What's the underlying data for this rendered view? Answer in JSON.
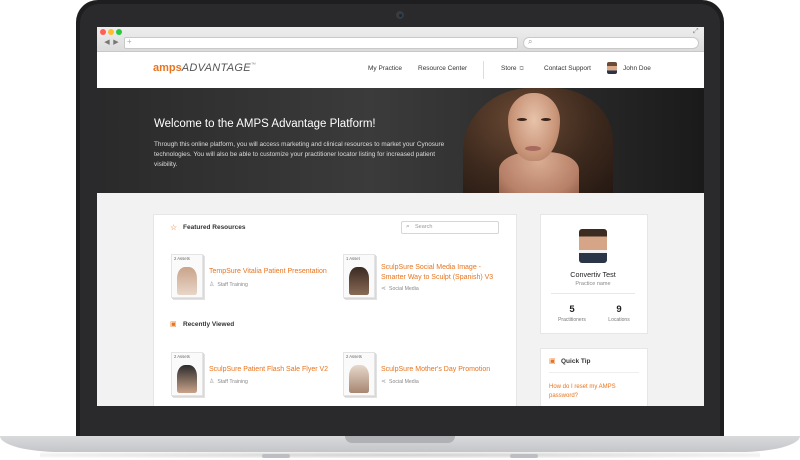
{
  "browser": {
    "traffic_lights": [
      "#ff5f57",
      "#febc2e",
      "#28c840"
    ],
    "back_glyph": "◀",
    "forward_glyph": "▶",
    "url_value": "",
    "search_value": ""
  },
  "site": {
    "logo": {
      "part1": "amps",
      "part2": "ADVANTAGE",
      "mark": "™"
    },
    "nav": {
      "my_practice": "My Practice",
      "resource_center": "Resource Center",
      "store": "Store",
      "contact_support": "Contact Support"
    },
    "user_name": "John Doe",
    "accent_color": "#e8741e"
  },
  "hero": {
    "title": "Welcome to the AMPS Advantage Platform!",
    "text": "Through this online platform, you will access marketing and clinical resources to market your Cynosure technologies. You will also be able to customize your practitioner locator listing for increased patient visibility."
  },
  "featured": {
    "title": "Featured Resources",
    "search_placeholder": "Search",
    "items": [
      {
        "badge": "2 Assets",
        "title": "TempSure Vitalia Patient Presentation",
        "category": "Staff Training",
        "icon": "person-icon"
      },
      {
        "badge": "1 Asset",
        "title": "SculpSure Social Media Image - Smarter Way to Sculpt (Spanish) V3",
        "category": "Social Media",
        "icon": "share-icon"
      }
    ]
  },
  "recent": {
    "title": "Recently Viewed",
    "items": [
      {
        "badge": "2 Assets",
        "title": "SculpSure Patient Flash Sale Flyer V2",
        "category": "Staff Training",
        "icon": "person-icon"
      },
      {
        "badge": "2 Assets",
        "title": "SculpSure Mother's Day Promotion",
        "category": "Social Media",
        "icon": "share-icon"
      }
    ]
  },
  "profile": {
    "name": "Convertiv Test",
    "role": "Practice name",
    "practitioners_count": "5",
    "practitioners_label": "Practitioners",
    "locations_count": "9",
    "locations_label": "Locations"
  },
  "quick_tip": {
    "title": "Quick Tip",
    "link": "How do I reset my AMPS password?"
  }
}
